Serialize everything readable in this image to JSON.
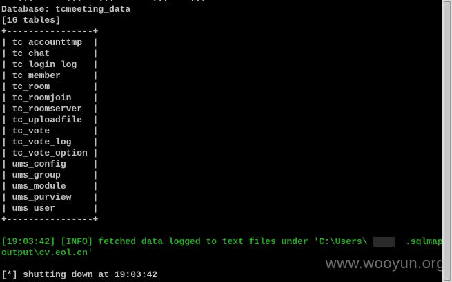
{
  "terminal": {
    "clipped_top_line": "   ...      ...   ...       ...    ...",
    "database_line": "Database: tcmeeting_data",
    "table_count": "[16 tables]",
    "border_top": "+----------------+",
    "rows": [
      "| tc_accounttmp  |",
      "| tc_chat        |",
      "| tc_login_log   |",
      "| tc_member      |",
      "| tc_room        |",
      "| tc_roomjoin    |",
      "| tc_roomserver  |",
      "| tc_uploadfile  |",
      "| tc_vote        |",
      "| tc_vote_log    |",
      "| tc_vote_option |",
      "| ums_config     |",
      "| ums_group      |",
      "| ums_module     |",
      "| ums_purview    |",
      "| ums_user       |"
    ],
    "border_bottom": "+----------------+",
    "info_line_1": "[19:03:42] [INFO] fetched data logged to text files under 'C:\\Users\\       .sqlmap\\",
    "info_line_2": "output\\cv.eol.cn'",
    "shutdown_line": "[*] shutting down at 19:03:42"
  },
  "watermark": "www.wooyun.org",
  "colors": {
    "background": "#000000",
    "text": "#c0c0c0",
    "info": "#2fa52f"
  }
}
